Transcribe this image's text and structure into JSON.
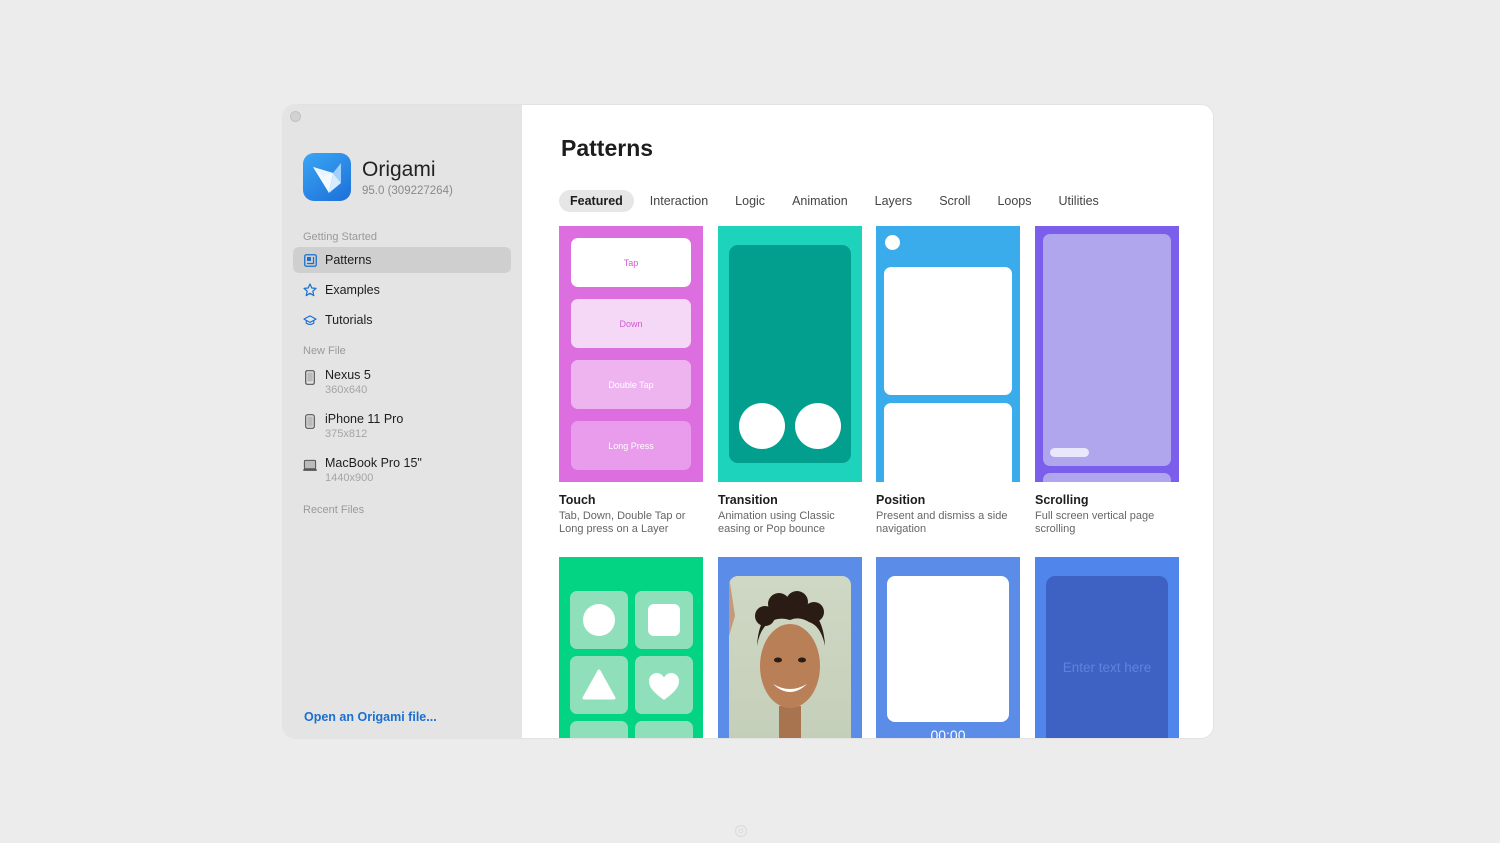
{
  "sidebar": {
    "app_name": "Origami",
    "app_version": "95.0 (309227264)",
    "sections": {
      "getting_started": "Getting Started",
      "new_file": "New File",
      "recent_files": "Recent Files"
    },
    "nav": [
      {
        "label": "Patterns",
        "icon": "patterns-icon",
        "active": true
      },
      {
        "label": "Examples",
        "icon": "star-icon",
        "active": false
      },
      {
        "label": "Tutorials",
        "icon": "graduation-cap-icon",
        "active": false
      }
    ],
    "files": [
      {
        "name": "Nexus 5",
        "dims": "360x640",
        "icon": "phone-icon"
      },
      {
        "name": "iPhone 11 Pro",
        "dims": "375x812",
        "icon": "phone-icon"
      },
      {
        "name": "MacBook Pro 15\"",
        "dims": "1440x900",
        "icon": "laptop-icon"
      }
    ],
    "open_link": "Open an Origami file..."
  },
  "main": {
    "title": "Patterns",
    "tabs": [
      "Featured",
      "Interaction",
      "Logic",
      "Animation",
      "Layers",
      "Scroll",
      "Loops",
      "Utilities"
    ],
    "active_tab": "Featured",
    "cards": [
      {
        "title": "Touch",
        "desc": "Tab, Down, Double Tap or Long press on a Layer",
        "labels": [
          "Tap",
          "Down",
          "Double Tap",
          "Long Press"
        ]
      },
      {
        "title": "Transition",
        "desc": "Animation using Classic easing or Pop bounce"
      },
      {
        "title": "Position",
        "desc": "Present and dismiss a side navigation"
      },
      {
        "title": "Scrolling",
        "desc": "Full screen vertical page scrolling"
      },
      {
        "title": "",
        "desc": ""
      },
      {
        "title": "",
        "desc": ""
      },
      {
        "title": "",
        "desc": "",
        "timer": "00:00"
      },
      {
        "title": "",
        "desc": "",
        "placeholder": "Enter text here"
      }
    ]
  },
  "colors": {
    "accent_link": "#1a6fd0",
    "touch": "#dd6ee0",
    "transition": "#1ed3bb",
    "position": "#3aacec",
    "scrolling": "#7c5eed",
    "shapes": "#03d483",
    "blue": "#5b8de8"
  }
}
